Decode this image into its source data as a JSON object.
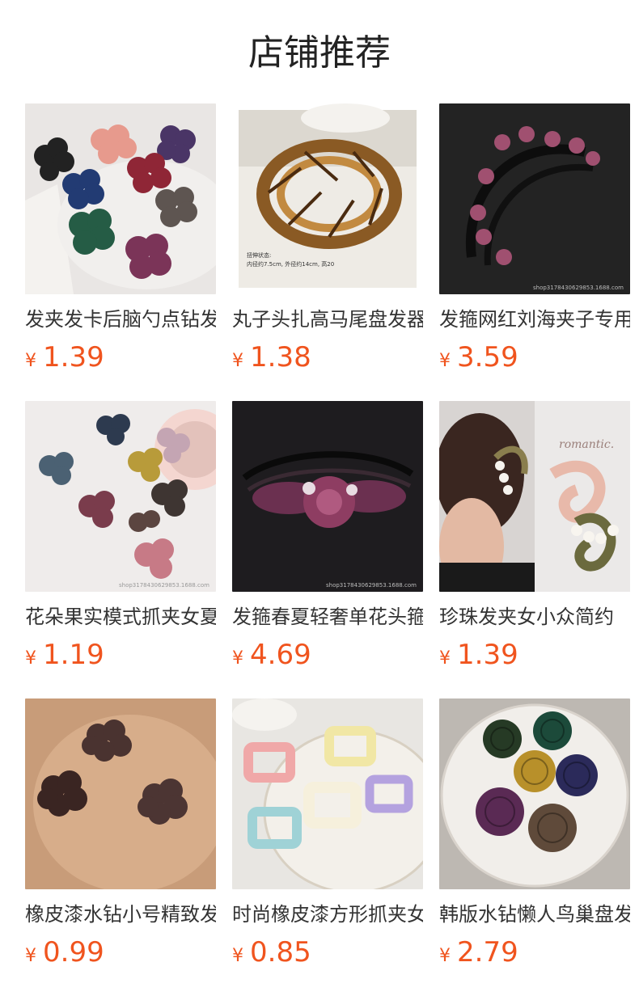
{
  "section": {
    "title": "店铺推荐"
  },
  "products": [
    {
      "name": "发夹发卡后脑勺点钻发",
      "currency": "¥",
      "price": "1.39",
      "image_icon": "flower-clips-image"
    },
    {
      "name": "丸子头扎高马尾盘发器",
      "currency": "¥",
      "price": "1.38",
      "image_icon": "bird-nest-bun-image"
    },
    {
      "name": "发箍网红刘海夹子专用",
      "currency": "¥",
      "price": "3.59",
      "image_icon": "rhinestone-headband-image"
    },
    {
      "name": "花朵果实模式抓夹女夏",
      "currency": "¥",
      "price": "1.19",
      "image_icon": "flower-barrettes-image"
    },
    {
      "name": "发箍春夏轻奢单花头箍",
      "currency": "¥",
      "price": "4.69",
      "image_icon": "crystal-flower-headband-image"
    },
    {
      "name": "珍珠发夹女小众简约",
      "currency": "¥",
      "price": "1.39",
      "image_icon": "pearl-claw-clip-image"
    },
    {
      "name": "橡皮漆水钻小号精致发",
      "currency": "¥",
      "price": "0.99",
      "image_icon": "small-flower-clips-image"
    },
    {
      "name": "时尚橡皮漆方形抓夹女",
      "currency": "¥",
      "price": "0.85",
      "image_icon": "square-claw-clips-image"
    },
    {
      "name": "韩版水钻懒人鸟巢盘发",
      "currency": "¥",
      "price": "2.79",
      "image_icon": "bird-nest-clips-image"
    }
  ],
  "colors": {
    "price": "#f0541e",
    "title": "#222222",
    "name": "#333333"
  }
}
